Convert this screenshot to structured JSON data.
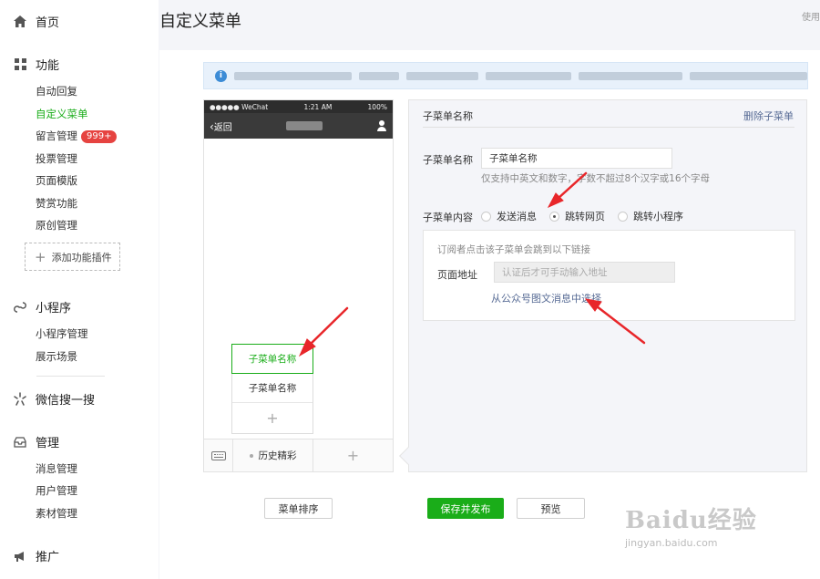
{
  "header": {
    "title": "自定义菜单",
    "top_right": "使用"
  },
  "sidebar": {
    "home": "首页",
    "features": {
      "label": "功能",
      "items": [
        "自动回复",
        "自定义菜单",
        "留言管理",
        "投票管理",
        "页面模版",
        "赞赏功能",
        "原创管理"
      ],
      "badge": "999+",
      "add_plugin": "添加功能插件"
    },
    "miniprogram": {
      "label": "小程序",
      "items": [
        "小程序管理",
        "展示场景"
      ]
    },
    "search": {
      "label": "微信搜一搜"
    },
    "manage": {
      "label": "管理",
      "items": [
        "消息管理",
        "用户管理",
        "素材管理"
      ]
    },
    "promote": {
      "label": "推广"
    },
    "colors": {
      "active": "#1aad19",
      "badge": "#e64340"
    }
  },
  "phone": {
    "carrier": "●●●●● WeChat",
    "time": "1:21 AM",
    "battery": "100%",
    "back": "返回",
    "submenu": [
      "子菜单名称",
      "子菜单名称"
    ],
    "add_symbol": "+",
    "main_menu": "历史精彩"
  },
  "editor": {
    "title": "子菜单名称",
    "delete": "删除子菜单",
    "name_label": "子菜单名称",
    "name_value": "子菜单名称",
    "hint": "仅支持中英文和数字，字数不超过8个汉字或16个字母",
    "content_label": "子菜单内容",
    "options": [
      "发送消息",
      "跳转网页",
      "跳转小程序"
    ],
    "selected_option": "跳转网页",
    "url_desc": "订阅者点击该子菜单会跳到以下链接",
    "url_label": "页面地址",
    "url_placeholder": "认证后才可手动输入地址",
    "url_link": "从公众号图文消息中选择"
  },
  "buttons": {
    "sort": "菜单排序",
    "save": "保存并发布",
    "preview": "预览"
  },
  "watermark": {
    "logo": "Baidu经验",
    "url": "jingyan.baidu.com"
  }
}
